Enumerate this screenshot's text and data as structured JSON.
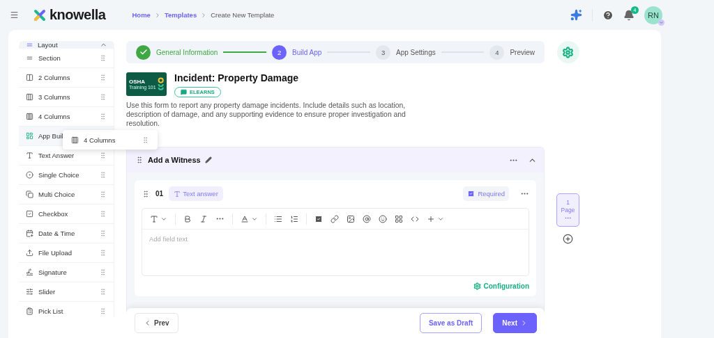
{
  "topbar": {
    "brand": "knowella",
    "breadcrumbs": [
      {
        "label": "Home",
        "link": true
      },
      {
        "label": "Templates",
        "link": true
      },
      {
        "label": "Create New Template",
        "link": false
      }
    ],
    "notifications": "4",
    "avatar": "RN"
  },
  "sidebar": {
    "title": "Layout",
    "expanded": true,
    "items": [
      {
        "label": "Section",
        "kind": "section",
        "selected": false
      },
      {
        "label": "2 Columns",
        "kind": "columns2",
        "selected": false
      },
      {
        "label": "3 Columns",
        "kind": "columns3",
        "selected": false
      },
      {
        "label": "4 Columns",
        "kind": "columns4",
        "selected": false
      },
      {
        "label": "App Buil",
        "kind": "app",
        "selected": true
      },
      {
        "label": "Text Answer",
        "kind": "text",
        "selected": false
      },
      {
        "label": "Single Choice",
        "kind": "single",
        "selected": false
      },
      {
        "label": "Multi Choice",
        "kind": "multi",
        "selected": false
      },
      {
        "label": "Checkbox",
        "kind": "checkbox",
        "selected": false
      },
      {
        "label": "Date & Time",
        "kind": "date",
        "selected": false
      },
      {
        "label": "File Upload",
        "kind": "upload",
        "selected": false
      },
      {
        "label": "Signature",
        "kind": "signature",
        "selected": false
      },
      {
        "label": "Slider",
        "kind": "slider",
        "selected": false
      },
      {
        "label": "Pick List",
        "kind": "picklist",
        "selected": false
      }
    ]
  },
  "drag_ghost": {
    "label": "4 Columns",
    "kind": "columns4"
  },
  "stepper": [
    {
      "label": "General Information",
      "completed": true,
      "selected": false
    },
    {
      "number": "2",
      "label": "Build App",
      "completed": false,
      "selected": true
    },
    {
      "number": "3",
      "label": "App Settings",
      "completed": false,
      "selected": false
    },
    {
      "number": "4",
      "label": "Preview",
      "completed": false,
      "selected": false
    }
  ],
  "template": {
    "thumbnail": {
      "title": "OSHA",
      "subtitle": "Training 101"
    },
    "title": "Incident: Property Damage",
    "badge": "ELEARNS",
    "description": "Use this form to report any property damage incidents. Include details such as location, description of damage, and any supporting evidence to ensure proper investigation and resolution."
  },
  "section": {
    "title": "Add a Witness",
    "expanded": true,
    "question": {
      "number": "01",
      "type_label": "Text answer",
      "required": true,
      "required_label": "Required",
      "placeholder": "Add field text",
      "config_label": "Configuration"
    }
  },
  "pages": [
    {
      "label": "1 Page",
      "selected": true
    }
  ],
  "footer": {
    "prev": "Prev",
    "draft": "Save as Draft",
    "next": "Next"
  }
}
